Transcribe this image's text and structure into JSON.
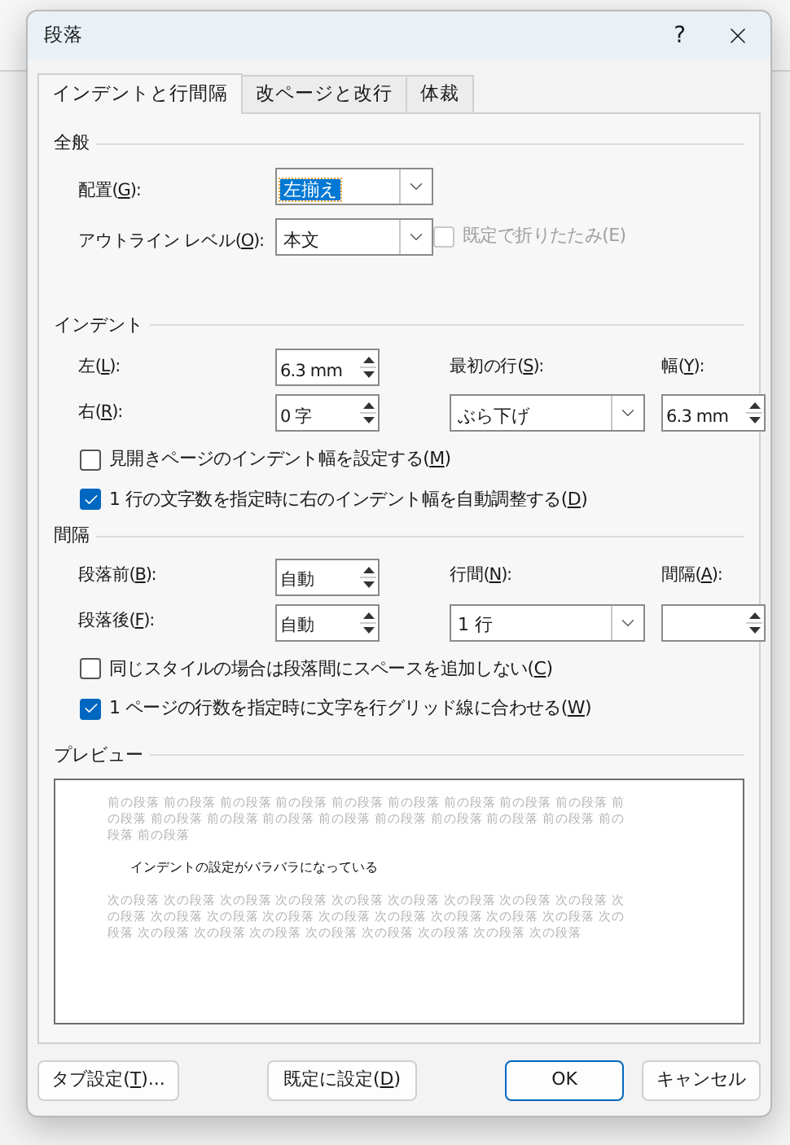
{
  "window": {
    "title": "段落",
    "help": "?"
  },
  "tabs": [
    {
      "label": "インデントと行間隔",
      "selected": true
    },
    {
      "label": "改ページと改行",
      "selected": false
    },
    {
      "label": "体裁",
      "selected": false
    }
  ],
  "general": {
    "heading": "全般",
    "alignment": {
      "label_parts": [
        "配置(",
        "G",
        "):"
      ],
      "value": "左揃え",
      "highlighted": true
    },
    "outline_level": {
      "label_parts": [
        "アウトライン レベル(",
        "O",
        "):"
      ],
      "value": "本文",
      "highlighted": false
    },
    "collapse": {
      "label_parts": [
        "既定で折りたたみ(E)"
      ],
      "checked": false,
      "disabled": true
    }
  },
  "indent": {
    "heading": "インデント",
    "left": {
      "label_parts": [
        "左(",
        "L",
        "):"
      ],
      "value": "6.3 mm"
    },
    "right": {
      "label_parts": [
        "右(",
        "R",
        "):"
      ],
      "value": "0 字"
    },
    "first_line": {
      "label_parts": [
        "最初の行(",
        "S",
        "):"
      ],
      "value": "ぶら下げ"
    },
    "by": {
      "label_parts": [
        "幅(",
        "Y",
        "):"
      ],
      "value": "6.3 mm"
    },
    "checkboxes": [
      {
        "label_parts": [
          "見開きページのインデント幅を設定する(",
          "M",
          ")"
        ],
        "checked": false,
        "disabled": false
      },
      {
        "label_parts": [
          "1 行の文字数を指定時に右のインデント幅を自動調整する(",
          "D",
          ")"
        ],
        "checked": true,
        "disabled": false
      }
    ]
  },
  "spacing": {
    "heading": "間隔",
    "before": {
      "label_parts": [
        "段落前(",
        "B",
        "):"
      ],
      "value": "自動"
    },
    "after": {
      "label_parts": [
        "段落後(",
        "F",
        "):"
      ],
      "value": "自動"
    },
    "line_spacing": {
      "label_parts": [
        "行間(",
        "N",
        "):"
      ],
      "value": "1 行"
    },
    "at": {
      "label_parts": [
        "間隔(",
        "A",
        "):"
      ]
    },
    "checkboxes": [
      {
        "label_parts": [
          "同じスタイルの場合は段落間にスペースを追加しない(",
          "C",
          ")"
        ],
        "checked": false,
        "disabled": false
      },
      {
        "label_parts": [
          "1 ページの行数を指定時に文字を行グリッド線に合わせる(",
          "W",
          ")"
        ],
        "checked": true,
        "disabled": false
      }
    ]
  },
  "preview": {
    "heading": "プレビュー",
    "previous_text": "前の段落 前の段落 前の段落 前の段落 前の段落 前の段落 前の段落 前の段落 前の段落 前の段落 前の段落 前の段落 前の段落 前の段落 前の段落 前の段落 前の段落 前の段落 前の段落 前の段落",
    "sample_text": "インデントの設定がバラバラになっている",
    "next_text": "次の段落 次の段落 次の段落 次の段落 次の段落 次の段落 次の段落 次の段落 次の段落 次の段落 次の段落 次の段落 次の段落 次の段落 次の段落 次の段落 次の段落 次の段落 次の段落 次の段落 次の段落 次の段落 次の段落 次の段落 次の段落 次の段落 次の段落"
  },
  "buttons": [
    {
      "label_parts": [
        "タブ設定(",
        "T",
        ")..."
      ],
      "kind": "normal"
    },
    {
      "label_parts": [
        "既定に設定(",
        "D",
        ")"
      ],
      "kind": "normal"
    },
    {
      "label_parts": [
        "OK"
      ],
      "kind": "default"
    },
    {
      "label_parts": [
        "キャンセル"
      ],
      "kind": "normal"
    }
  ]
}
